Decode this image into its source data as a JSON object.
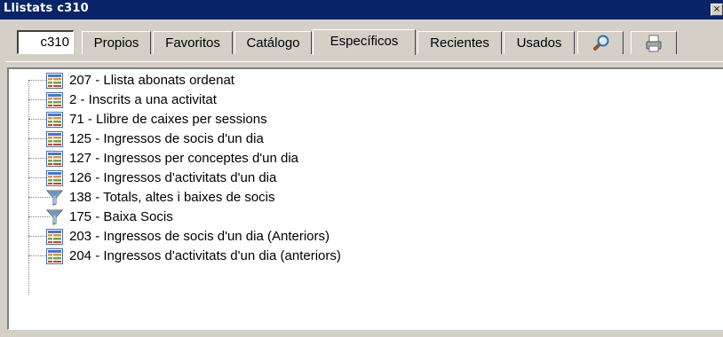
{
  "window": {
    "title": "Llistats c310",
    "close_symbol": "×"
  },
  "search": {
    "value": "c310"
  },
  "tabs": [
    {
      "label": "Propios"
    },
    {
      "label": "Favoritos"
    },
    {
      "label": "Catálogo"
    },
    {
      "label": "Específicos",
      "active": true
    },
    {
      "label": "Recientes"
    },
    {
      "label": "Usados"
    },
    {
      "icon": "magnifier-icon"
    },
    {
      "icon": "printer-icon"
    }
  ],
  "tree": {
    "items": [
      {
        "label": "207 - Llista abonats ordenat",
        "icon": "report-icon"
      },
      {
        "label": "2 - Inscrits a una activitat",
        "icon": "report-icon"
      },
      {
        "label": "71 - Llibre de caixes per sessions",
        "icon": "report-icon"
      },
      {
        "label": "125 - Ingressos de socis d'un dia",
        "icon": "report-icon"
      },
      {
        "label": "127 - Ingressos per conceptes d'un dia",
        "icon": "report-icon"
      },
      {
        "label": "126 - Ingressos d'activitats d'un dia",
        "icon": "report-icon"
      },
      {
        "label": "138 - Totals, altes i baixes de socis",
        "icon": "funnel-icon"
      },
      {
        "label": "175 - Baixa Socis",
        "icon": "funnel-icon"
      },
      {
        "label": "203 - Ingressos de socis d'un dia (Anteriors)",
        "icon": "report-icon"
      },
      {
        "label": "204 - Ingressos d'activitats d'un dia (anteriors)",
        "icon": "report-icon"
      }
    ]
  },
  "colors": {
    "titlebar": "#0a246a",
    "face": "#d4d0c8",
    "tree_background": "#ffffff"
  }
}
